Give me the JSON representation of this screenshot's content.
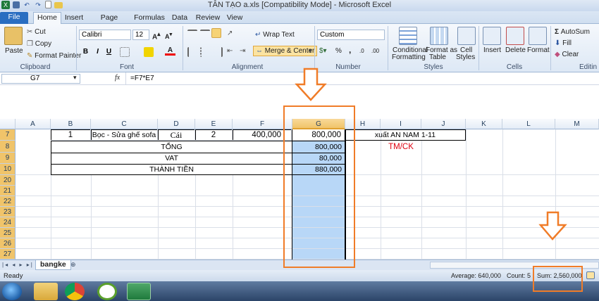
{
  "window": {
    "title": "TÂN TẠO a.xls  [Compatibility Mode]  -  Microsoft Excel"
  },
  "ribbon_tabs": [
    "File",
    "Home",
    "Insert",
    "Page Layout",
    "Formulas",
    "Data",
    "Review",
    "View"
  ],
  "clipboard": {
    "paste": "Paste",
    "cut": "Cut",
    "copy": "Copy",
    "format_painter": "Format Painter",
    "group": "Clipboard"
  },
  "font": {
    "name": "Calibri",
    "size": "12",
    "bold": "B",
    "italic": "I",
    "underline": "U",
    "group": "Font"
  },
  "alignment": {
    "wrap_text": "Wrap Text",
    "merge_center": "Merge & Center",
    "group": "Alignment"
  },
  "number": {
    "format": "Custom",
    "group": "Number",
    "percent": "%",
    "comma": ",",
    "dec_inc": ".0",
    ".00": ".00"
  },
  "styles": {
    "conditional": "Conditional",
    "formatting": "Formatting",
    "format_as": "Format as",
    "table": "Table",
    "cell": "Cell",
    "cell_styles": "Styles",
    "group": "Styles"
  },
  "cells": {
    "insert": "Insert",
    "delete": "Delete",
    "format": "Format",
    "group": "Cells"
  },
  "editing": {
    "autosum": "AutoSum",
    "fill": "Fill",
    "clear": "Clear",
    "group": "Editin"
  },
  "formula_bar": {
    "name_box": "G7",
    "fx": "fx",
    "formula": "=F7*E7"
  },
  "columns": [
    "A",
    "B",
    "C",
    "D",
    "E",
    "F",
    "G",
    "H",
    "I",
    "J",
    "K",
    "L",
    "M"
  ],
  "rows": [
    "7",
    "8",
    "9",
    "10",
    "20",
    "21",
    "22",
    "23",
    "24",
    "25",
    "26",
    "27"
  ],
  "cells_data": {
    "b7": "1",
    "c7": "Bọc - Sửa ghế sofa",
    "d7": "Cái",
    "e7": "2",
    "f7": "400,000",
    "g7": "800,000",
    "h7": "xuất AN NAM 1-11",
    "c8": "TỔNG",
    "g8": "800,000",
    "h8": "TM/CK",
    "c9": "VAT",
    "g9": "80,000",
    "c10": "THÀNH TIỀN",
    "g10": "880,000"
  },
  "sheet_tabs": {
    "active": "bangke"
  },
  "status": {
    "ready": "Ready",
    "average": "Average:  640,000",
    "count": "Count: 5",
    "sum": "Sum:  2,560,000"
  },
  "colors": {
    "accent": "#f07c28",
    "selection": "#b8d7f7",
    "file_tab": "#2a6ec1",
    "red_text": "#e0000f"
  }
}
